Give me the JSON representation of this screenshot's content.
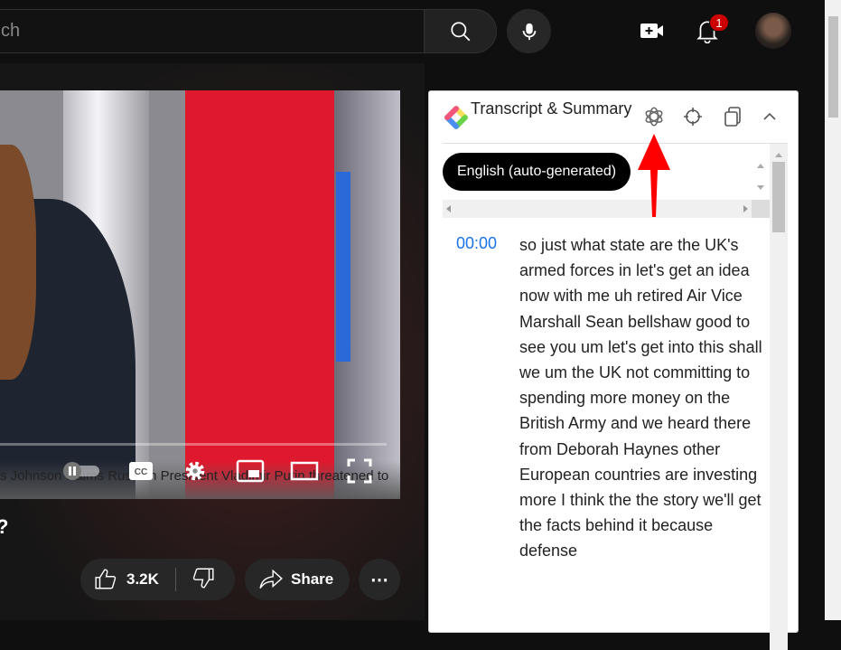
{
  "header": {
    "search_placeholder": "ch",
    "notification_count": "1",
    "icons": [
      "search-icon",
      "microphone-icon",
      "create-video-icon",
      "bell-icon",
      "avatar"
    ]
  },
  "video": {
    "ticker_text": "s Johnson claims Russian President Vladimir Putin threatened to",
    "title_fragment": "?",
    "progress_percent": 0
  },
  "actions": {
    "likes": "3.2K",
    "share_label": "Share",
    "more_label": "⋯"
  },
  "panel": {
    "title": "Transcript & Summary",
    "icons": [
      "chatgpt-icon",
      "crosshair-icon",
      "copy-icon",
      "chevron-up-icon"
    ],
    "language_button": "English (auto-generated)",
    "entries": [
      {
        "time": "00:00",
        "text": "so just what state are the UK's armed forces in let's get an idea now with me uh retired Air Vice Marshall Sean bellshaw good to see you um let's get into this shall we um the UK not committing to spending more money on the British Army and we heard there from Deborah Haynes other European countries are investing more I think the the story we'll get the facts behind it because defense"
      }
    ]
  },
  "colors": {
    "accent_link": "#1a73e8",
    "annotation_arrow": "#ff0000",
    "badge": "#cc0000"
  }
}
